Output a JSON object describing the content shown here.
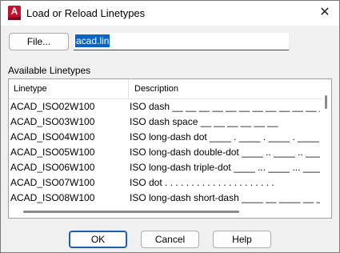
{
  "window": {
    "title": "Load or Reload Linetypes",
    "app_icon_letter": "A",
    "close_glyph": "✕"
  },
  "file_row": {
    "file_button_label": "File...",
    "filename_value": "acad.lin"
  },
  "list": {
    "group_label": "Available Linetypes",
    "columns": [
      "Linetype",
      "Description"
    ],
    "rows": [
      {
        "linetype": "ACAD_ISO02W100",
        "description": "ISO dash __ __ __ __ __ __ __ __ __ __ __ __ __"
      },
      {
        "linetype": "ACAD_ISO03W100",
        "description": "ISO dash space __    __    __    __    __    __"
      },
      {
        "linetype": "ACAD_ISO04W100",
        "description": "ISO long-dash dot ____ . ____ . ____ . ____ . _"
      },
      {
        "linetype": "ACAD_ISO05W100",
        "description": "ISO long-dash double-dot ____ .. ____ .. ____ ."
      },
      {
        "linetype": "ACAD_ISO06W100",
        "description": "ISO long-dash triple-dot ____ ... ____ ... ____"
      },
      {
        "linetype": "ACAD_ISO07W100",
        "description": "ISO dot . . . . . . . . . . . . . . . . . . . . ."
      },
      {
        "linetype": "ACAD_ISO08W100",
        "description": "ISO long-dash short-dash ____ __ ____ __ ____ _"
      }
    ]
  },
  "buttons": {
    "ok": "OK",
    "cancel": "Cancel",
    "help": "Help"
  },
  "colors": {
    "accent": "#1a5fb4",
    "selection": "#0a64c8",
    "brand_red": "#c8102e"
  }
}
